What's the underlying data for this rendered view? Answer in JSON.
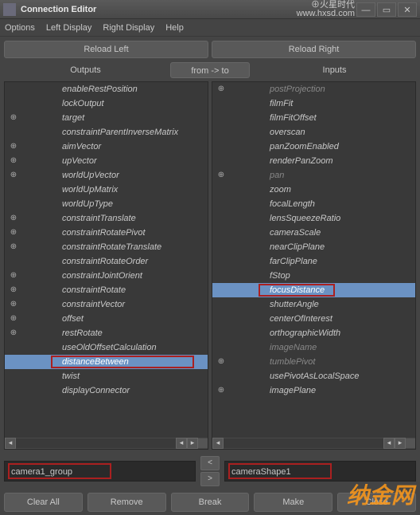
{
  "title": "Connection Editor",
  "watermark_top": "⊕火星时代",
  "watermark_url": "www.hxsd.com",
  "menu": {
    "options": "Options",
    "left": "Left Display",
    "right": "Right Display",
    "help": "Help"
  },
  "reload": {
    "left": "Reload Left",
    "right": "Reload Right"
  },
  "headers": {
    "outputs": "Outputs",
    "fromto": "from -> to",
    "inputs": "Inputs"
  },
  "outputs": [
    {
      "exp": "",
      "label": "enableRestPosition",
      "dim": false
    },
    {
      "exp": "",
      "label": "lockOutput",
      "dim": false
    },
    {
      "exp": "⊕",
      "label": "target",
      "dim": false
    },
    {
      "exp": "",
      "label": "constraintParentInverseMatrix",
      "dim": false
    },
    {
      "exp": "⊕",
      "label": "aimVector",
      "dim": false
    },
    {
      "exp": "⊕",
      "label": "upVector",
      "dim": false
    },
    {
      "exp": "⊕",
      "label": "worldUpVector",
      "dim": false
    },
    {
      "exp": "",
      "label": "worldUpMatrix",
      "dim": false
    },
    {
      "exp": "",
      "label": "worldUpType",
      "dim": false
    },
    {
      "exp": "⊕",
      "label": "constraintTranslate",
      "dim": false
    },
    {
      "exp": "⊕",
      "label": "constraintRotatePivot",
      "dim": false
    },
    {
      "exp": "⊕",
      "label": "constraintRotateTranslate",
      "dim": false
    },
    {
      "exp": "",
      "label": "constraintRotateOrder",
      "dim": false
    },
    {
      "exp": "⊕",
      "label": "constraintJointOrient",
      "dim": false
    },
    {
      "exp": "⊕",
      "label": "constraintRotate",
      "dim": false
    },
    {
      "exp": "⊕",
      "label": "constraintVector",
      "dim": false
    },
    {
      "exp": "⊕",
      "label": "offset",
      "dim": false
    },
    {
      "exp": "⊕",
      "label": "restRotate",
      "dim": false
    },
    {
      "exp": "",
      "label": "useOldOffsetCalculation",
      "dim": false
    },
    {
      "exp": "",
      "label": "distanceBetween",
      "dim": false,
      "selected": true
    },
    {
      "exp": "",
      "label": "twist",
      "dim": false
    },
    {
      "exp": "",
      "label": "displayConnector",
      "dim": false
    }
  ],
  "inputs": [
    {
      "exp": "⊕",
      "label": "postProjection",
      "dim": true
    },
    {
      "exp": "",
      "label": "filmFit",
      "dim": false
    },
    {
      "exp": "",
      "label": "filmFitOffset",
      "dim": false
    },
    {
      "exp": "",
      "label": "overscan",
      "dim": false
    },
    {
      "exp": "",
      "label": "panZoomEnabled",
      "dim": false
    },
    {
      "exp": "",
      "label": "renderPanZoom",
      "dim": false
    },
    {
      "exp": "⊕",
      "label": "pan",
      "dim": true
    },
    {
      "exp": "",
      "label": "zoom",
      "dim": false
    },
    {
      "exp": "",
      "label": "focalLength",
      "dim": false
    },
    {
      "exp": "",
      "label": "lensSqueezeRatio",
      "dim": false
    },
    {
      "exp": "",
      "label": "cameraScale",
      "dim": false
    },
    {
      "exp": "",
      "label": "nearClipPlane",
      "dim": false
    },
    {
      "exp": "",
      "label": "farClipPlane",
      "dim": false
    },
    {
      "exp": "",
      "label": "fStop",
      "dim": false
    },
    {
      "exp": "",
      "label": "focusDistance",
      "dim": false,
      "selected": true,
      "redbox": true
    },
    {
      "exp": "",
      "label": "shutterAngle",
      "dim": false
    },
    {
      "exp": "",
      "label": "centerOfInterest",
      "dim": false
    },
    {
      "exp": "",
      "label": "orthographicWidth",
      "dim": false
    },
    {
      "exp": "",
      "label": "imageName",
      "dim": true
    },
    {
      "exp": "⊕",
      "label": "tumblePivot",
      "dim": true
    },
    {
      "exp": "",
      "label": "usePivotAsLocalSpace",
      "dim": false
    },
    {
      "exp": "⊕",
      "label": "imagePlane",
      "dim": false
    }
  ],
  "fields": {
    "left": "camera1_group",
    "right": "cameraShape1"
  },
  "buttons": {
    "clear": "Clear All",
    "remove": "Remove",
    "break": "Break",
    "make": "Make",
    "close": "Close"
  },
  "logo": "纳金网"
}
